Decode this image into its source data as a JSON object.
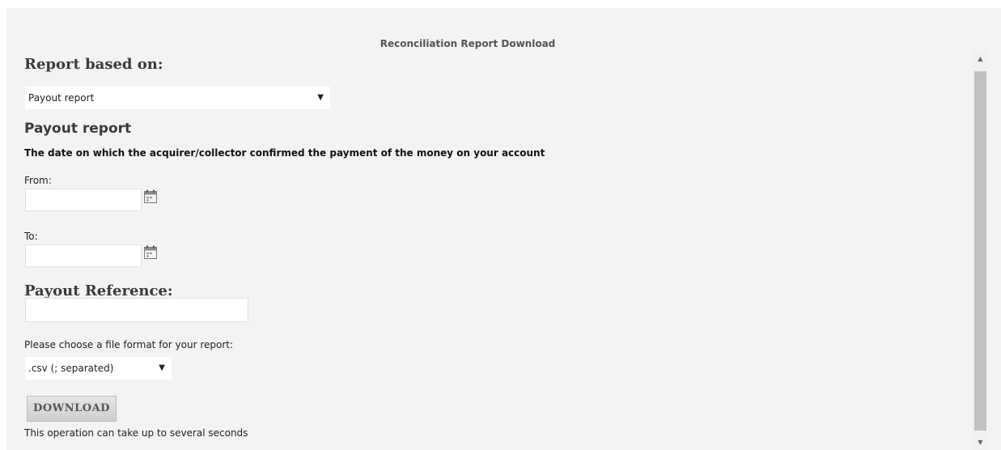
{
  "header": {
    "title": "Reconciliation Report Download"
  },
  "report_based": {
    "heading": "Report based on:",
    "select_value": "Payout report",
    "arrow_icon": "triangle-down"
  },
  "payout": {
    "heading": "Payout report",
    "description": "The date on which the acquirer/collector confirmed the payment of the money on your account",
    "from_label": "From:",
    "from_value": "",
    "to_label": "To:",
    "to_value": "",
    "calendar_icon": "calendar-icon"
  },
  "reference": {
    "heading": "Payout Reference:",
    "value": ""
  },
  "format": {
    "label": "Please choose a file format for your report:",
    "select_value": ".csv (; separated)"
  },
  "actions": {
    "download_label": "DOWNLOAD",
    "note": "This operation can take up to several seconds"
  },
  "scrollbar": {
    "up_icon": "scroll-up-arrow",
    "down_icon": "scroll-down-arrow"
  }
}
